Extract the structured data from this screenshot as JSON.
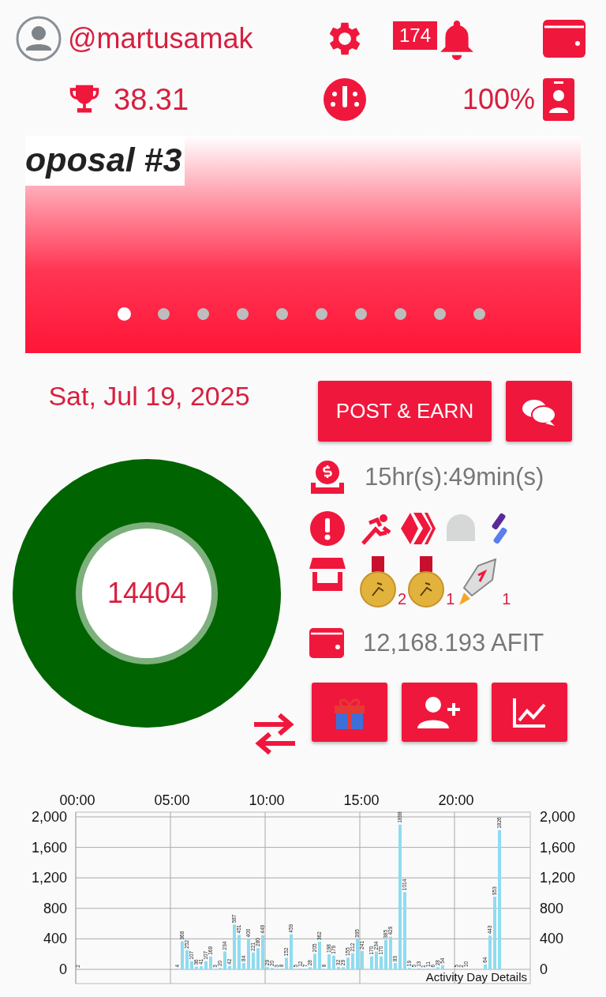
{
  "header": {
    "username": "@martusamak",
    "score": "38.31",
    "notification_count": "174",
    "percent": "100%"
  },
  "banner": {
    "title": "oposal #3",
    "dots": [
      {
        "selected": true
      },
      {
        "selected": false
      },
      {
        "selected": false
      },
      {
        "selected": false
      },
      {
        "selected": false
      },
      {
        "selected": false
      },
      {
        "selected": false
      },
      {
        "selected": false
      },
      {
        "selected": false
      },
      {
        "selected": false
      }
    ]
  },
  "date": "Sat, Jul 19, 2025",
  "post_button": "POST & EARN",
  "steps": "14404",
  "timer": "15hr(s):49min(s)",
  "rewards": [
    {
      "kind": "medal",
      "count": "2"
    },
    {
      "kind": "medal",
      "count": "1"
    },
    {
      "kind": "rocket",
      "count": "1"
    }
  ],
  "balance": "12,168.193 AFIT",
  "activity": {
    "chart_data": {
      "type": "bar",
      "title": "Activity Day Details",
      "ylim": [
        0,
        2000
      ],
      "categories": [
        "00:00",
        null,
        null,
        null,
        null,
        null,
        null,
        null,
        null,
        null,
        null,
        null,
        null,
        null,
        null,
        null,
        null,
        null,
        null,
        null,
        "05:00",
        null,
        null,
        null,
        null,
        null,
        null,
        null,
        null,
        null,
        null,
        null,
        null,
        null,
        null,
        null,
        null,
        null,
        null,
        null,
        "10:00",
        null,
        null,
        null,
        null,
        null,
        null,
        null,
        null,
        null,
        null,
        null,
        null,
        null,
        null,
        null,
        null,
        null,
        null,
        null,
        "15:00",
        null,
        null,
        null,
        null,
        null,
        null,
        null,
        null,
        null,
        null,
        null,
        null,
        null,
        null,
        null,
        null,
        null,
        null,
        null,
        "20:00",
        null,
        null,
        null,
        null,
        null,
        null,
        null,
        null,
        null,
        null,
        null,
        null,
        null,
        null,
        null
      ],
      "yticks": [
        {
          "value": 0,
          "label": "0"
        },
        {
          "value": 400,
          "label": "400"
        },
        {
          "value": 800,
          "label": "800"
        },
        {
          "value": 1200,
          "label": "1,200"
        },
        {
          "value": 1600,
          "label": "1,600"
        },
        {
          "value": 2000,
          "label": "2,000"
        }
      ],
      "data_labels": true,
      "grid": true,
      "values": [
        2,
        null,
        null,
        null,
        null,
        null,
        null,
        null,
        null,
        null,
        null,
        null,
        null,
        null,
        null,
        null,
        null,
        null,
        null,
        null,
        null,
        4,
        368,
        252,
        107,
        36,
        41,
        107,
        168,
        3,
        20,
        234,
        42,
        587,
        451,
        84,
        400,
        221,
        280,
        449,
        29,
        20,
        3,
        8,
        152,
        459,
        5,
        12,
        7,
        28,
        205,
        362,
        8,
        198,
        179,
        32,
        29,
        155,
        212,
        395,
        241,
        null,
        170,
        234,
        170,
        385,
        429,
        83,
        1898,
        1014,
        19,
        5,
        13,
        1,
        11,
        6,
        28,
        54,
        null,
        null,
        5,
        2,
        10,
        null,
        null,
        null,
        64,
        443,
        953,
        1826,
        null,
        null,
        null,
        null,
        null,
        null
      ]
    }
  }
}
